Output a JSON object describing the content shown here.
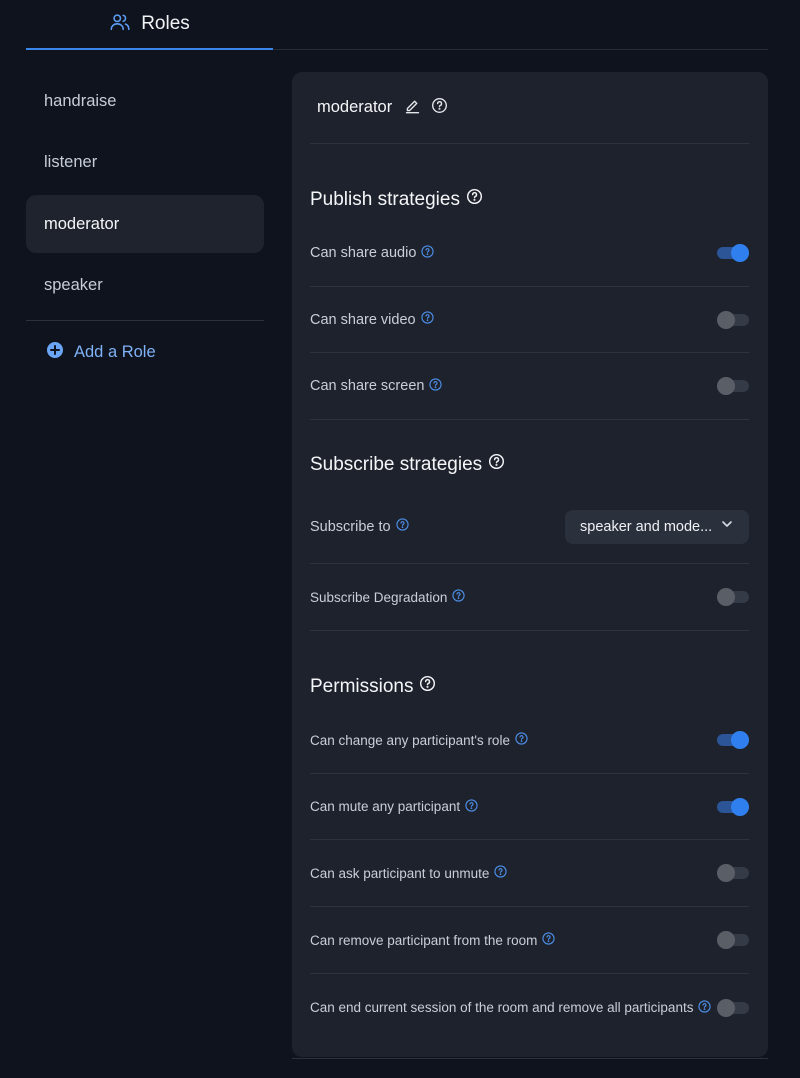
{
  "tabs": [
    {
      "label": "Roles",
      "icon": "users-icon",
      "active": true
    }
  ],
  "sidebar": {
    "roles": [
      {
        "label": "handraise",
        "active": false
      },
      {
        "label": "listener",
        "active": false
      },
      {
        "label": "moderator",
        "active": true
      },
      {
        "label": "speaker",
        "active": false
      }
    ],
    "add_role_label": "Add a Role"
  },
  "role": {
    "name": "moderator"
  },
  "publish": {
    "title": "Publish strategies",
    "items": [
      {
        "label": "Can share audio",
        "enabled": true
      },
      {
        "label": "Can share video",
        "enabled": false
      },
      {
        "label": "Can share screen",
        "enabled": false
      }
    ]
  },
  "subscribe": {
    "title": "Subscribe strategies",
    "subscribe_to_label": "Subscribe to",
    "subscribe_to_value": "speaker and mode...",
    "degradation_label": "Subscribe Degradation",
    "degradation_enabled": false
  },
  "permissions": {
    "title": "Permissions",
    "items": [
      {
        "label": "Can change any participant's role",
        "enabled": true
      },
      {
        "label": "Can mute any participant",
        "enabled": true
      },
      {
        "label": "Can ask participant to unmute",
        "enabled": false
      },
      {
        "label": "Can remove participant from the room",
        "enabled": false
      },
      {
        "label": "Can end current session of the room and remove all participants",
        "enabled": false
      }
    ]
  },
  "colors": {
    "accent": "#2f80ee",
    "background": "#0f131d",
    "panel": "#1e222d",
    "link": "#7fb2f6"
  }
}
